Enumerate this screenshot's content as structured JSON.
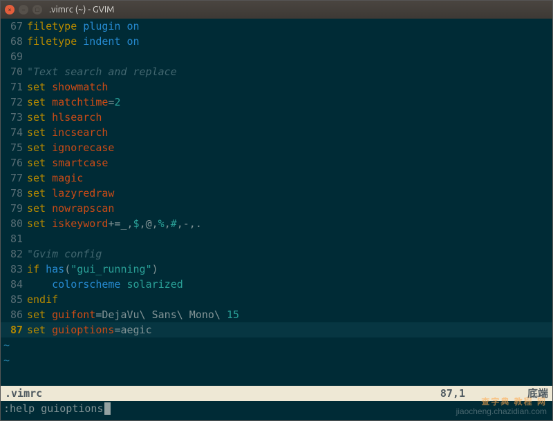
{
  "window": {
    "title": ".vimrc (~) - GVIM"
  },
  "lines": [
    {
      "n": 67,
      "tokens": [
        [
          "tk-kw",
          "filetype"
        ],
        [
          "tk-norm",
          " "
        ],
        [
          "tk-cmd",
          "plugin"
        ],
        [
          "tk-norm",
          " "
        ],
        [
          "tk-cmd",
          "on"
        ]
      ]
    },
    {
      "n": 68,
      "tokens": [
        [
          "tk-kw",
          "filetype"
        ],
        [
          "tk-norm",
          " "
        ],
        [
          "tk-cmd",
          "indent"
        ],
        [
          "tk-norm",
          " "
        ],
        [
          "tk-cmd",
          "on"
        ]
      ]
    },
    {
      "n": 69,
      "tokens": []
    },
    {
      "n": 70,
      "tokens": [
        [
          "tk-cmt",
          "\"Text search and replace"
        ]
      ]
    },
    {
      "n": 71,
      "tokens": [
        [
          "tk-kw",
          "set"
        ],
        [
          "tk-norm",
          " "
        ],
        [
          "tk-opt",
          "showmatch"
        ]
      ]
    },
    {
      "n": 72,
      "tokens": [
        [
          "tk-kw",
          "set"
        ],
        [
          "tk-norm",
          " "
        ],
        [
          "tk-opt",
          "matchtime"
        ],
        [
          "tk-norm",
          "="
        ],
        [
          "tk-num",
          "2"
        ]
      ]
    },
    {
      "n": 73,
      "tokens": [
        [
          "tk-kw",
          "set"
        ],
        [
          "tk-norm",
          " "
        ],
        [
          "tk-opt",
          "hlsearch"
        ]
      ]
    },
    {
      "n": 74,
      "tokens": [
        [
          "tk-kw",
          "set"
        ],
        [
          "tk-norm",
          " "
        ],
        [
          "tk-opt",
          "incsearch"
        ]
      ]
    },
    {
      "n": 75,
      "tokens": [
        [
          "tk-kw",
          "set"
        ],
        [
          "tk-norm",
          " "
        ],
        [
          "tk-opt",
          "ignorecase"
        ]
      ]
    },
    {
      "n": 76,
      "tokens": [
        [
          "tk-kw",
          "set"
        ],
        [
          "tk-norm",
          " "
        ],
        [
          "tk-opt",
          "smartcase"
        ]
      ]
    },
    {
      "n": 77,
      "tokens": [
        [
          "tk-kw",
          "set"
        ],
        [
          "tk-norm",
          " "
        ],
        [
          "tk-opt",
          "magic"
        ]
      ]
    },
    {
      "n": 78,
      "tokens": [
        [
          "tk-kw",
          "set"
        ],
        [
          "tk-norm",
          " "
        ],
        [
          "tk-opt",
          "lazyredraw"
        ]
      ]
    },
    {
      "n": 79,
      "tokens": [
        [
          "tk-kw",
          "set"
        ],
        [
          "tk-norm",
          " "
        ],
        [
          "tk-opt",
          "nowrapscan"
        ]
      ]
    },
    {
      "n": 80,
      "tokens": [
        [
          "tk-kw",
          "set"
        ],
        [
          "tk-norm",
          " "
        ],
        [
          "tk-opt",
          "iskeyword"
        ],
        [
          "tk-norm",
          "+=_,"
        ],
        [
          "tk-num",
          "$"
        ],
        [
          "tk-norm",
          ",@,"
        ],
        [
          "tk-num",
          "%"
        ],
        [
          "tk-norm",
          ","
        ],
        [
          "tk-num",
          "#"
        ],
        [
          "tk-norm",
          ",-,."
        ]
      ]
    },
    {
      "n": 81,
      "tokens": []
    },
    {
      "n": 82,
      "tokens": [
        [
          "tk-cmt",
          "\"Gvim config"
        ]
      ]
    },
    {
      "n": 83,
      "tokens": [
        [
          "tk-kw",
          "if"
        ],
        [
          "tk-norm",
          " "
        ],
        [
          "tk-fn",
          "has"
        ],
        [
          "tk-norm",
          "("
        ],
        [
          "tk-str",
          "\"gui_running\""
        ],
        [
          "tk-norm",
          ")"
        ]
      ]
    },
    {
      "n": 84,
      "tokens": [
        [
          "tk-norm",
          "    "
        ],
        [
          "tk-cmd",
          "colorscheme"
        ],
        [
          "tk-norm",
          " "
        ],
        [
          "tk-num",
          "solarized"
        ]
      ]
    },
    {
      "n": 85,
      "tokens": [
        [
          "tk-kw",
          "endif"
        ]
      ]
    },
    {
      "n": 86,
      "tokens": [
        [
          "tk-kw",
          "set"
        ],
        [
          "tk-norm",
          " "
        ],
        [
          "tk-opt",
          "guifont"
        ],
        [
          "tk-norm",
          "=DejaVu\\ Sans\\ Mono\\ "
        ],
        [
          "tk-num",
          "15"
        ]
      ]
    },
    {
      "n": 87,
      "current": true,
      "tokens": [
        [
          "tk-kw",
          "set"
        ],
        [
          "tk-norm",
          " "
        ],
        [
          "tk-opt",
          "guioptions"
        ],
        [
          "tk-norm",
          "=aegic"
        ]
      ]
    }
  ],
  "tildes": 2,
  "status": {
    "file": ".vimrc",
    "pos": "87,1",
    "right": "底端"
  },
  "cmdline": ":help guioptions",
  "watermark": {
    "top": "查字典 教程 网",
    "bottom": "jiaocheng.chazidian.com"
  }
}
